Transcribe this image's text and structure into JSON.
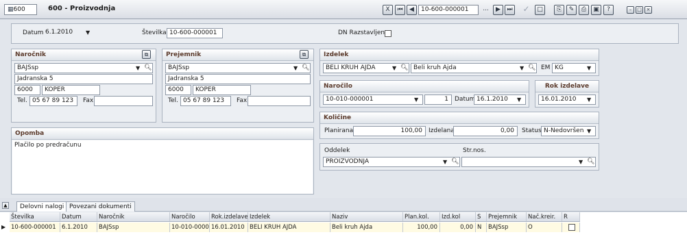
{
  "window": {
    "id": "600",
    "title": "600 - Proizvodnja"
  },
  "toolbar": {
    "record": "10-600-000001",
    "dots": "..."
  },
  "header": {
    "datum_label": "Datum",
    "datum_value": "6.1.2010",
    "stevilka_label": "Številka",
    "stevilka_value": "10-600-000001",
    "razstavljen_label": "DN Razstavljen"
  },
  "narocnik": {
    "title": "Naročnik",
    "code": "BAJSsp",
    "address": "Jadranska 5",
    "postal": "6000",
    "city": "KOPER",
    "tel_label": "Tel.",
    "tel": "05 67 89 123",
    "fax_label": "Fax",
    "fax": ""
  },
  "prejemnik": {
    "title": "Prejemnik",
    "code": "BAJSsp",
    "address": "Jadranska 5",
    "postal": "6000",
    "city": "KOPER",
    "tel_label": "Tel.",
    "tel": "05 67 89 123",
    "fax_label": "Fax",
    "fax": ""
  },
  "izdelek": {
    "title": "Izdelek",
    "code": "BELI KRUH AJDA",
    "name": "Beli kruh Ajda",
    "em_label": "EM",
    "em_value": "KG"
  },
  "narocilo": {
    "title": "Naročilo",
    "number": "10-010-000001",
    "qty": "1",
    "datum_label": "Datum",
    "datum": "16.1.2010"
  },
  "rok": {
    "title": "Rok izdelave",
    "value": "16.01.2010"
  },
  "kolicine": {
    "title": "Količine",
    "planirana_label": "Planirana",
    "planirana": "100,00",
    "izdelana_label": "Izdelana",
    "izdelana": "0,00",
    "status_label": "Status",
    "status": "N-Nedovršen"
  },
  "oddelek": {
    "label": "Oddelek",
    "value": "PROIZVODNJA",
    "strnos_label": "Str.nos.",
    "strnos": ""
  },
  "opomba": {
    "title": "Opomba",
    "text": "Plačilo po predračunu"
  },
  "tabs": [
    "Delovni nalogi",
    "Povezani dokumenti"
  ],
  "grid": {
    "columns": [
      "Številka",
      "Datum",
      "Naročnik",
      "Naročilo",
      "Rok.izdelave",
      "Izdelek",
      "Naziv",
      "Plan.kol.",
      "Izd.kol",
      "S",
      "Prejemnik",
      "Nač.kreir.",
      "R"
    ],
    "rows": [
      [
        "10-600-000001",
        "6.1.2010",
        "BAJSsp",
        "10-010-0000",
        "16.01.2010",
        "BELI KRUH AJDA",
        "Beli kruh Ajda",
        "100,00",
        "0,00",
        "N",
        "BAJSsp",
        "O",
        ""
      ]
    ]
  }
}
